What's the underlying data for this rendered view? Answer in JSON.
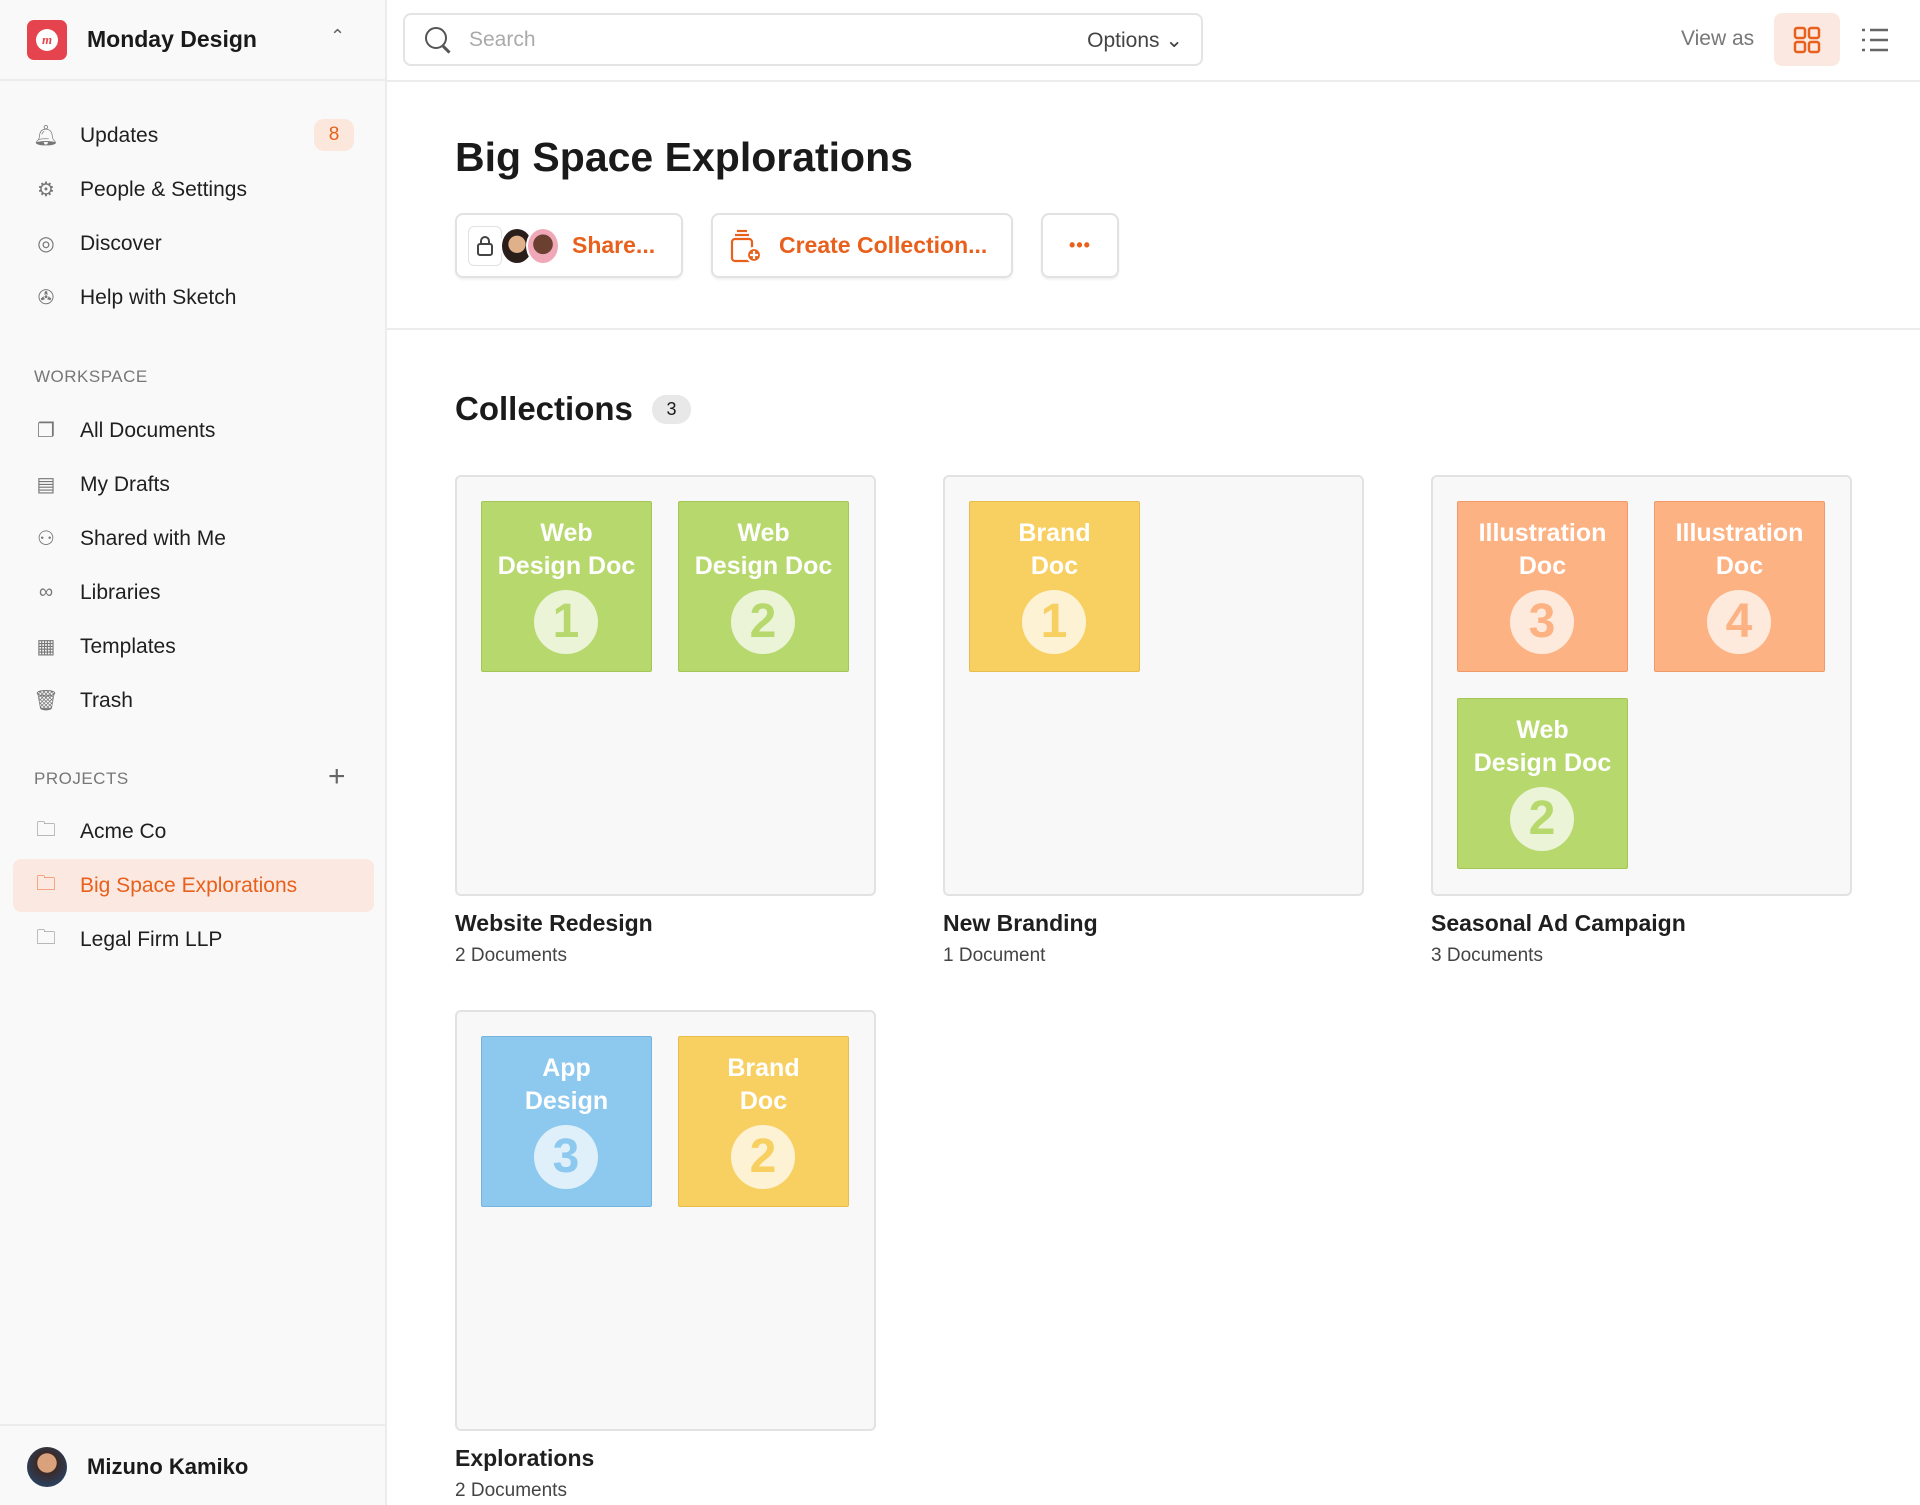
{
  "workspace": {
    "name": "Monday Design"
  },
  "sidebar": {
    "items": [
      {
        "label": "Updates",
        "icon": "bell-icon",
        "badge": "8"
      },
      {
        "label": "People & Settings",
        "icon": "gear-icon"
      },
      {
        "label": "Discover",
        "icon": "compass-icon"
      },
      {
        "label": "Help with Sketch",
        "icon": "lifebuoy-icon"
      }
    ],
    "workspace_label": "WORKSPACE",
    "workspace_items": [
      {
        "label": "All Documents",
        "icon": "documents-icon"
      },
      {
        "label": "My Drafts",
        "icon": "drafts-icon"
      },
      {
        "label": "Shared with Me",
        "icon": "people-icon"
      },
      {
        "label": "Libraries",
        "icon": "libraries-icon"
      },
      {
        "label": "Templates",
        "icon": "templates-icon"
      },
      {
        "label": "Trash",
        "icon": "trash-icon"
      }
    ],
    "projects_label": "PROJECTS",
    "projects": [
      {
        "label": "Acme Co"
      },
      {
        "label": "Big Space Explorations",
        "active": true
      },
      {
        "label": "Legal Firm LLP"
      }
    ],
    "user": "Mizuno Kamiko"
  },
  "header": {
    "search_placeholder": "Search",
    "options_label": "Options",
    "view_as": "View as"
  },
  "page": {
    "title": "Big Space Explorations",
    "share_label": "Share...",
    "create_label": "Create Collection...",
    "more_label": "•••"
  },
  "collections": {
    "heading": "Collections",
    "count": "3",
    "items": [
      {
        "title": "Website Redesign",
        "subtitle": "2 Documents",
        "docs": [
          {
            "line1": "Web",
            "line2": "Design Doc",
            "num": "1",
            "color": "green"
          },
          {
            "line1": "Web",
            "line2": "Design Doc",
            "num": "2",
            "color": "green"
          }
        ]
      },
      {
        "title": "New Branding",
        "subtitle": "1 Document",
        "docs": [
          {
            "line1": "Brand",
            "line2": "Doc",
            "num": "1",
            "color": "yellow"
          }
        ]
      },
      {
        "title": "Seasonal Ad Campaign",
        "subtitle": "3 Documents",
        "docs": [
          {
            "line1": "Illustration",
            "line2": "Doc",
            "num": "3",
            "color": "orange"
          },
          {
            "line1": "Illustration",
            "line2": "Doc",
            "num": "4",
            "color": "orange"
          },
          {
            "line1": "Web",
            "line2": "Design Doc",
            "num": "2",
            "color": "green"
          }
        ]
      },
      {
        "title": "Explorations",
        "subtitle": "2 Documents",
        "docs": [
          {
            "line1": "App",
            "line2": "Design",
            "num": "3",
            "color": "blue"
          },
          {
            "line1": "Brand",
            "line2": "Doc",
            "num": "2",
            "color": "yellow"
          }
        ]
      }
    ]
  },
  "colors": {
    "accent": "#e8601c",
    "green": "#b7d86d",
    "yellow": "#f8d062",
    "orange": "#fcb283",
    "blue": "#8dc8ee"
  }
}
